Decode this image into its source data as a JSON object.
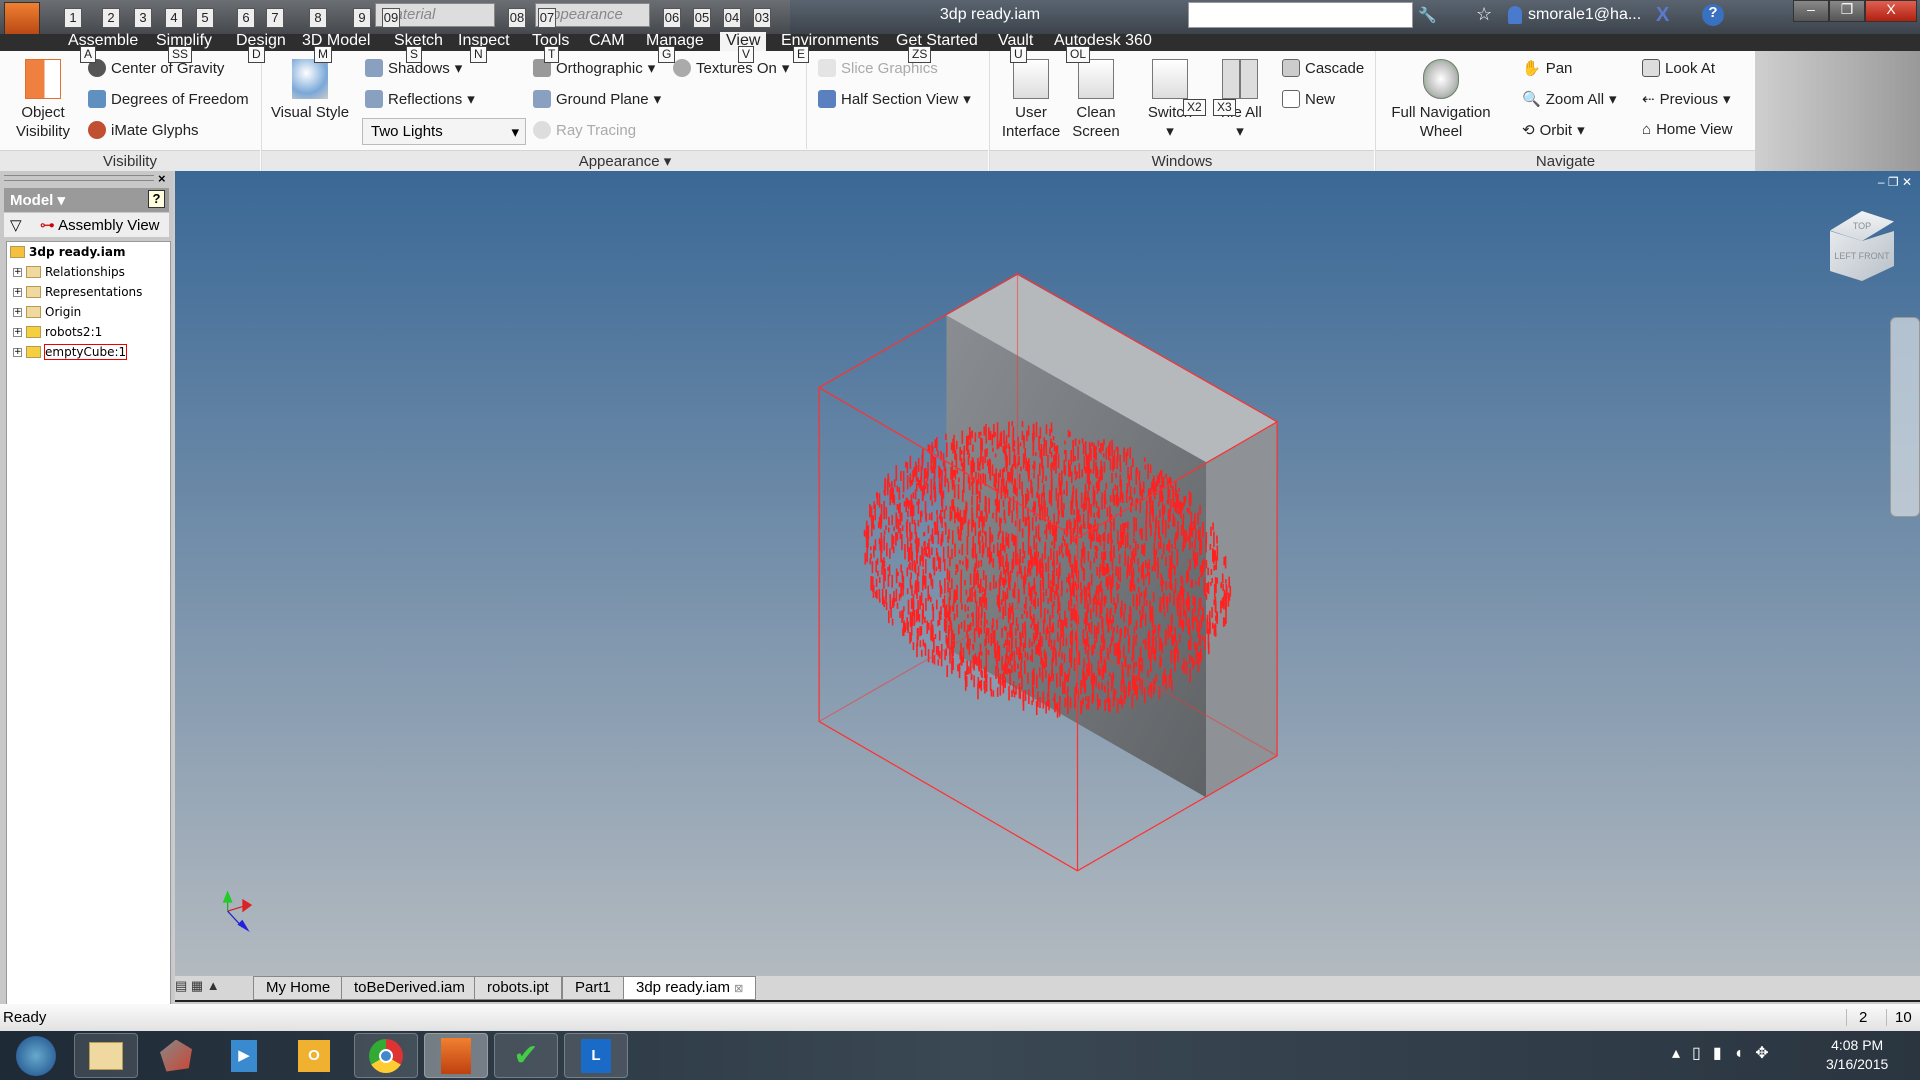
{
  "window": {
    "title": "3dp ready.iam",
    "user": "smorale1@ha...",
    "minimize": "–",
    "restore": "❐",
    "close": "X"
  },
  "qat": {
    "material": "Material",
    "appearance": "Appearance",
    "keys": [
      "1",
      "2",
      "3",
      "4",
      "5",
      "6",
      "7",
      "8",
      "9",
      "09",
      "08",
      "07",
      "06",
      "05",
      "04",
      "03"
    ]
  },
  "menu": {
    "tabs": [
      {
        "label": "Assemble",
        "key": "A"
      },
      {
        "label": "Simplify",
        "key": "SS"
      },
      {
        "label": "Design",
        "key": "D"
      },
      {
        "label": "3D Model",
        "key": "M"
      },
      {
        "label": "Sketch",
        "key": "S"
      },
      {
        "label": "Inspect",
        "key": "N"
      },
      {
        "label": "Tools",
        "key": "T"
      },
      {
        "label": "CAM",
        "key": ""
      },
      {
        "label": "Manage",
        "key": "G"
      },
      {
        "label": "View",
        "key": "V"
      },
      {
        "label": "Environments",
        "key": "E"
      },
      {
        "label": "Get Started",
        "key": "ZS"
      },
      {
        "label": "Vault",
        "key": "U"
      },
      {
        "label": "Autodesk 360",
        "key": "OL"
      }
    ],
    "active": "View"
  },
  "ribbon": {
    "visibility": {
      "label": "Visibility",
      "object_visibility": "Object Visibility",
      "center_of_gravity": "Center of Gravity",
      "degrees_of_freedom": "Degrees of Freedom",
      "imate_glyphs": "iMate Glyphs"
    },
    "appearance": {
      "label": "Appearance",
      "visual_style": "Visual Style",
      "shadows": "Shadows",
      "reflections": "Reflections",
      "lighting": "Two Lights",
      "orthographic": "Orthographic",
      "ground_plane": "Ground Plane",
      "ray_tracing": "Ray Tracing",
      "textures_on": "Textures On",
      "slice_graphics": "Slice Graphics",
      "half_section_view": "Half Section View"
    },
    "windows": {
      "label": "Windows",
      "user_interface": "User Interface",
      "clean_screen": "Clean Screen",
      "switch": "Switch",
      "tile_all": "Tile All",
      "cascade": "Cascade",
      "new": "New",
      "keys": {
        "x2": "X2",
        "x3": "X3"
      }
    },
    "navigate": {
      "label": "Navigate",
      "full_navigation_wheel": "Full Navigation Wheel",
      "pan": "Pan",
      "zoom_all": "Zoom All",
      "orbit": "Orbit",
      "look_at": "Look At",
      "previous": "Previous",
      "home_view": "Home View"
    }
  },
  "browser": {
    "title": "Model",
    "view": "Assembly View",
    "root": "3dp ready.iam",
    "items": [
      "Relationships",
      "Representations",
      "Origin",
      "robots2:1",
      "emptyCube:1"
    ],
    "selected": "emptyCube:1"
  },
  "viewcube": {
    "top": "TOP",
    "left": "LEFT",
    "front": "FRONT"
  },
  "doc_tabs": [
    {
      "label": "My Home"
    },
    {
      "label": "toBeDerived.iam"
    },
    {
      "label": "robots.ipt"
    },
    {
      "label": "Part1"
    },
    {
      "label": "3dp ready.iam",
      "active": true
    }
  ],
  "status": {
    "text": "Ready",
    "count1": "2",
    "count2": "10"
  },
  "clock": {
    "time": "4:08 PM",
    "date": "3/16/2015"
  },
  "colors": {
    "accent_red": "#ff2020",
    "viewport_top": "#3a6896",
    "viewport_bottom": "#b3bac0"
  }
}
